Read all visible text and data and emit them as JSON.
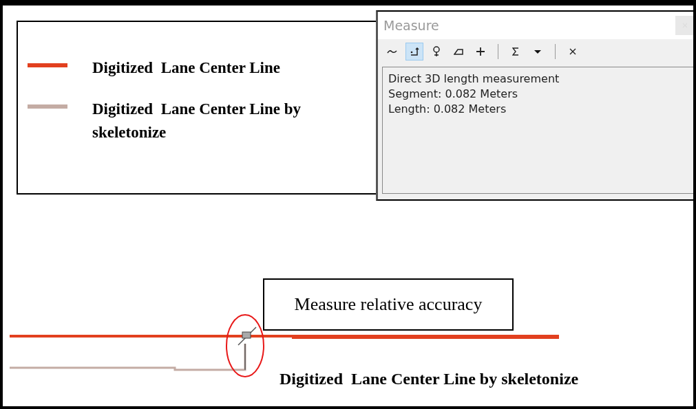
{
  "legend": {
    "items": [
      {
        "label": "Digitized  Lane Center Line",
        "color": "#e2401f"
      },
      {
        "label": "Digitized  Lane Center Line by skeletonize",
        "color": "#c4aca4"
      }
    ]
  },
  "measure_window": {
    "title": "Measure",
    "tool_groups": [
      [
        {
          "kind": "line",
          "selected": false
        },
        {
          "kind": "feature",
          "selected": true
        },
        {
          "kind": "pin",
          "selected": false
        },
        {
          "kind": "area",
          "selected": false
        },
        {
          "kind": "plus",
          "selected": false
        }
      ],
      [
        {
          "kind": "sigma",
          "selected": false
        },
        {
          "kind": "dropdown",
          "selected": false
        }
      ],
      [
        {
          "kind": "clear",
          "selected": false
        }
      ]
    ],
    "output": [
      "Direct 3D length measurement",
      "Segment: 0.082 Meters",
      "Length: 0.082 Meters"
    ]
  },
  "map": {
    "callout": "Measure relative accuracy",
    "label": "Digitized  Lane Center Line by skeletonize"
  }
}
